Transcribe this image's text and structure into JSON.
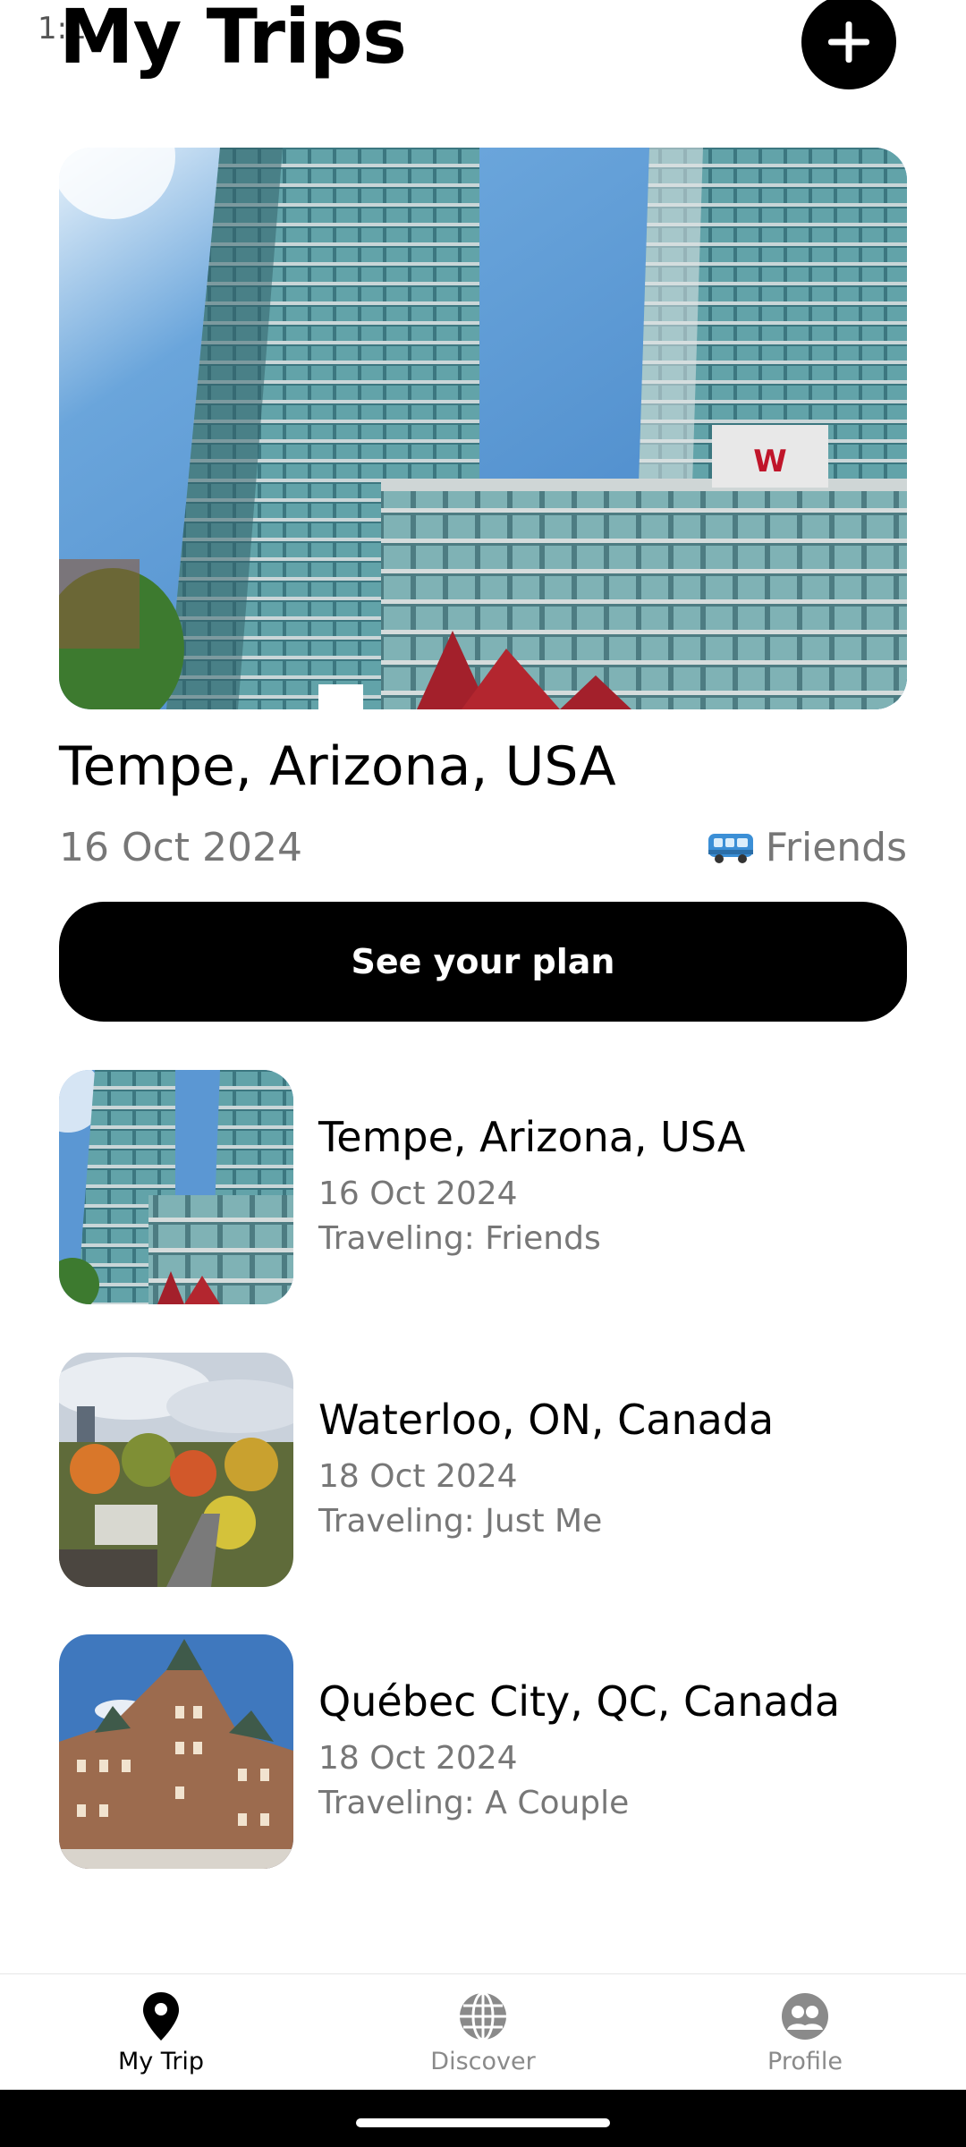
{
  "status_bar": {
    "time": "1:1"
  },
  "header": {
    "title": "My Trips"
  },
  "featured_trip": {
    "title": "Tempe, Arizona, USA",
    "date": "16 Oct 2024",
    "companion": "Friends",
    "companion_icon": "bus-icon",
    "plan_button_label": "See your plan"
  },
  "trips": [
    {
      "name": "Tempe, Arizona, USA",
      "date": "16 Oct 2024",
      "traveling": "Traveling: Friends"
    },
    {
      "name": "Waterloo, ON, Canada",
      "date": "18 Oct 2024",
      "traveling": "Traveling: Just Me"
    },
    {
      "name": "Québec City, QC, Canada",
      "date": "18 Oct 2024",
      "traveling": "Traveling: A Couple"
    }
  ],
  "bottom_nav": {
    "items": [
      {
        "label": "My Trip",
        "icon": "map-pin-icon",
        "active": true
      },
      {
        "label": "Discover",
        "icon": "globe-icon",
        "active": false
      },
      {
        "label": "Profile",
        "icon": "people-icon",
        "active": false
      }
    ]
  },
  "colors": {
    "accent": "#000000",
    "muted_text": "#777777",
    "nav_inactive": "#8a8a8a"
  }
}
